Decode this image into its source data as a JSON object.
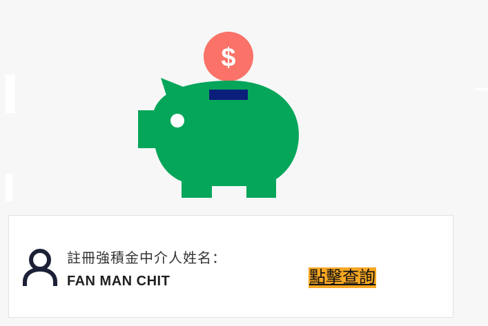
{
  "illustration": {
    "icon": "piggy-bank-icon",
    "coin_icon": "dollar-coin-icon",
    "coin_symbol": "$",
    "colors": {
      "pig_body": "#06a65a",
      "coin": "#fa7268",
      "coin_slot": "#0b1f7a",
      "pig_eye": "#ffffff"
    }
  },
  "intermediary_card": {
    "avatar_icon": "user-icon",
    "label": "註冊強積金中介人姓名：",
    "name": "FAN MAN CHIT",
    "query_link": "點擊查詢",
    "colors": {
      "link_highlight": "#f5a623",
      "avatar": "#1d2137"
    }
  }
}
